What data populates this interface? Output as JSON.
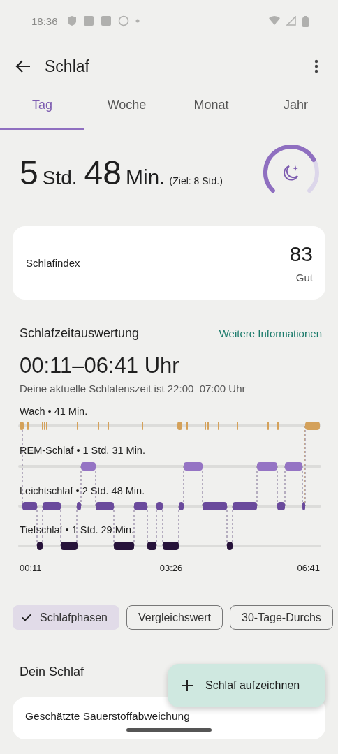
{
  "status_bar": {
    "time": "18:36"
  },
  "header": {
    "title": "Schlaf"
  },
  "tabs": [
    {
      "label": "Tag",
      "selected": true
    },
    {
      "label": "Woche",
      "selected": false
    },
    {
      "label": "Monat",
      "selected": false
    },
    {
      "label": "Jahr",
      "selected": false
    }
  ],
  "summary": {
    "hours": "5",
    "hours_unit": "Std.",
    "minutes": "48",
    "minutes_unit": "Min.",
    "goal": "(Ziel: 8 Std.)"
  },
  "score_card": {
    "label": "Schlafindex",
    "value": "83",
    "rating": "Gut"
  },
  "analysis": {
    "title": "Schlafzeitauswertung",
    "link": "Weitere Informationen",
    "range": "00:11–06:41 Uhr",
    "bedtime_note": "Deine aktuelle Schlafenszeit ist 22:00–07:00 Uhr",
    "phases": [
      {
        "label": "Wach • 41 Min."
      },
      {
        "label": "REM-Schlaf • 1 Std. 31 Min."
      },
      {
        "label": "Leichtschlaf • 2 Std. 48 Min."
      },
      {
        "label": "Tiefschlaf • 1 Std. 29 Min."
      }
    ],
    "time_labels": [
      "00:11",
      "03:26",
      "06:41"
    ]
  },
  "chips": [
    {
      "label": "Schlafphasen",
      "selected": true
    },
    {
      "label": "Vergleichswert",
      "selected": false
    },
    {
      "label": "30-Tage-Durchs",
      "selected": false
    }
  ],
  "section": {
    "title": "Dein Schlaf"
  },
  "fab": {
    "label": "Schlaf aufzeichnen"
  },
  "card_preview": {
    "title": "Geschätzte Sauerstoffabweichung"
  }
}
